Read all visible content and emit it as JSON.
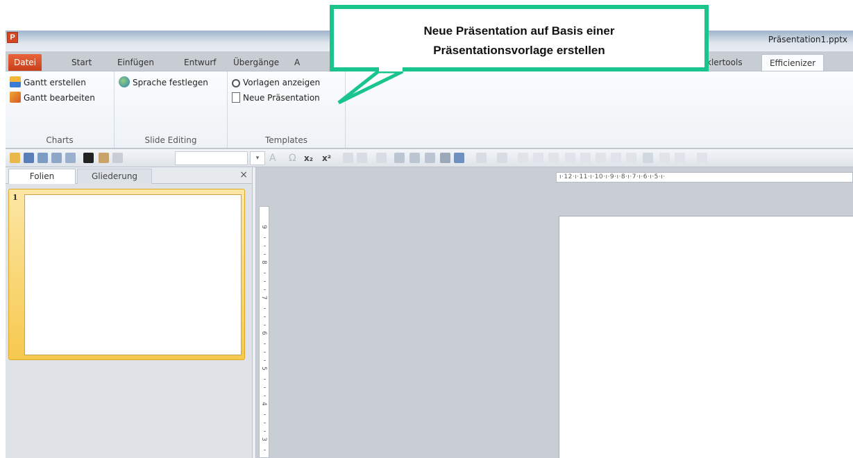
{
  "window": {
    "app_logo": "P",
    "doc_title": "Präsentation1.pptx"
  },
  "tabs": {
    "datei": "Datei",
    "start": "Start",
    "einfuegen": "Einfügen",
    "entwurf": "Entwurf",
    "uebergaenge": "Übergänge",
    "animationen_partial": "A",
    "entwicklertools_partial": "klertools",
    "efficienizer": "Efficienizer"
  },
  "ribbon": {
    "charts": {
      "gantt_new": "Gantt erstellen",
      "gantt_edit": "Gantt bearbeiten",
      "label": "Charts"
    },
    "slide_editing": {
      "language": "Sprache festlegen",
      "label": "Slide Editing"
    },
    "templates": {
      "show": "Vorlagen anzeigen",
      "new": "Neue Präsentation",
      "label": "Templates"
    }
  },
  "toolbar": {
    "font_size_arrow": "▾",
    "font_color": "A",
    "omega": "Ω",
    "subscript": "x₂",
    "superscript": "x²"
  },
  "pane": {
    "tab_folien": "Folien",
    "tab_gliederung": "Gliederung",
    "close": "×",
    "slide_number": "1"
  },
  "ruler": {
    "horizontal": "ı·12·ı·11·ı·10·ı·9·ı·8·ı·7·ı·6·ı·5·ı·",
    "vertical": [
      "9",
      "8",
      "7",
      "6",
      "5",
      "4",
      "3"
    ]
  },
  "callout": {
    "line1": "Neue Präsentation auf Basis einer",
    "line2": "Präsentationsvorlage erstellen",
    "border_color": "#19c48d"
  },
  "colors": {
    "datei_tab": "#d24726",
    "selection": "#f6c94e"
  }
}
